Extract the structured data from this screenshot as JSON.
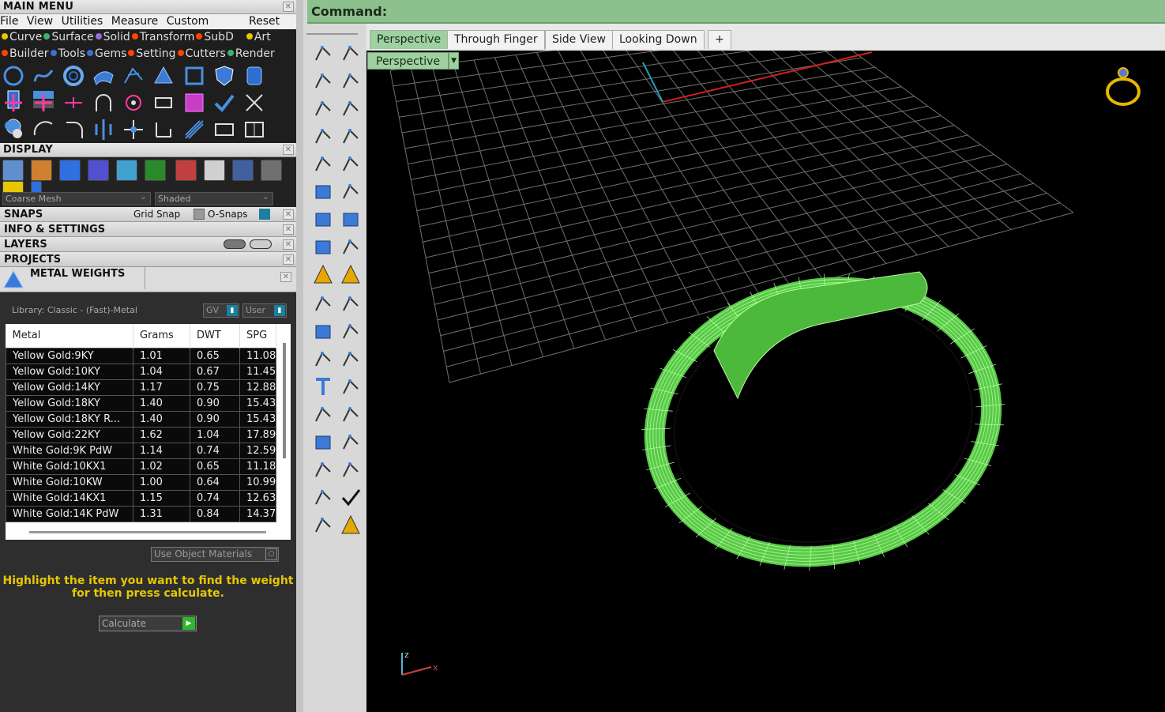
{
  "main_menu": {
    "title": "MAIN MENU",
    "menu_items": [
      "File",
      "View",
      "Utilities",
      "Measure",
      "Custom"
    ],
    "reset_label": "Reset",
    "categories_row1": [
      {
        "label": "Curve",
        "color": "#e6c800"
      },
      {
        "label": "Surface",
        "color": "#3cb371"
      },
      {
        "label": "Solid",
        "color": "#9370db"
      },
      {
        "label": "Transform",
        "color": "#ff4500"
      },
      {
        "label": "SubD",
        "color": "#ff4500"
      },
      {
        "label": "Art",
        "color": "#e6c800"
      }
    ],
    "categories_row2": [
      {
        "label": "Builder",
        "color": "#ff4500"
      },
      {
        "label": "Tools",
        "color": "#3a6fd8"
      },
      {
        "label": "Gems",
        "color": "#3a6fd8"
      },
      {
        "label": "Setting",
        "color": "#ff4500"
      },
      {
        "label": "Cutters",
        "color": "#ff4500"
      },
      {
        "label": "Render",
        "color": "#3cb371"
      }
    ]
  },
  "display": {
    "title": "DISPLAY",
    "mesh_select": "Coarse Mesh",
    "shade_select": "Shaded"
  },
  "snaps": {
    "title": "SNAPS",
    "grid_snap": "Grid Snap",
    "osnaps": "O-Snaps"
  },
  "info_settings": {
    "title": "INFO & SETTINGS"
  },
  "layers": {
    "title": "LAYERS"
  },
  "projects": {
    "title": "PROJECTS"
  },
  "metal_weights": {
    "title": "METAL WEIGHTS",
    "library": "Library: Classic - (Fast)-Metal",
    "gv_label": "GV",
    "user_label": "User",
    "columns": [
      "Metal",
      "Grams",
      "DWT",
      "SPG"
    ],
    "rows": [
      [
        "Yellow Gold:9KY",
        "1.01",
        "0.65",
        "11.08"
      ],
      [
        "Yellow Gold:10KY",
        "1.04",
        "0.67",
        "11.45"
      ],
      [
        "Yellow Gold:14KY",
        "1.17",
        "0.75",
        "12.88"
      ],
      [
        "Yellow Gold:18KY",
        "1.40",
        "0.90",
        "15.43"
      ],
      [
        "Yellow Gold:18KY R...",
        "1.40",
        "0.90",
        "15.43"
      ],
      [
        "Yellow Gold:22KY",
        "1.62",
        "1.04",
        "17.89"
      ],
      [
        "White Gold:9K PdW",
        "1.14",
        "0.74",
        "12.59"
      ],
      [
        "White Gold:10KX1",
        "1.02",
        "0.65",
        "11.18"
      ],
      [
        "White Gold:10KW",
        "1.00",
        "0.64",
        "10.99"
      ],
      [
        "White Gold:14KX1",
        "1.15",
        "0.74",
        "12.63"
      ],
      [
        "White Gold:14K PdW",
        "1.31",
        "0.84",
        "14.37"
      ]
    ],
    "use_object_materials": "Use Object Materials",
    "hint_line1": "Highlight the item you want to find the weight",
    "hint_line2": "for then press calculate.",
    "calculate": "Calculate"
  },
  "command": {
    "label": "Command:"
  },
  "tabs": [
    "Perspective",
    "Through Finger",
    "Side View",
    "Looking Down"
  ],
  "add_tab": "+",
  "viewport": {
    "label": "Perspective",
    "axis_x": "x",
    "axis_z": "z"
  },
  "colors": {
    "accent_green": "#9fd09f",
    "ring_wire": "#66ff55",
    "hint_yellow": "#e6c800"
  }
}
